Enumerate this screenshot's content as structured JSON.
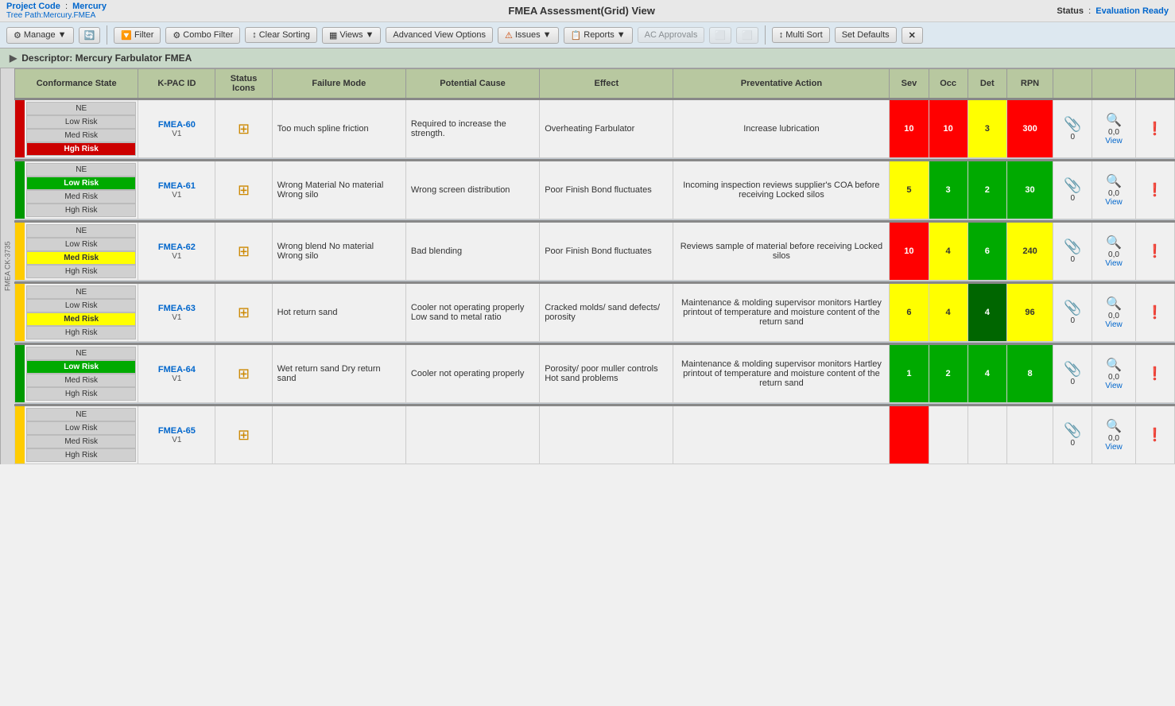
{
  "header": {
    "project_label": "Project Code",
    "project_value": "Mercury",
    "tree_path": "Tree Path:Mercury.FMEA",
    "title": "FMEA Assessment(Grid) View",
    "status_label": "Status",
    "status_value": "Evaluation Ready"
  },
  "toolbar": {
    "manage": "Manage",
    "filter": "Filter",
    "combo_filter": "Combo Filter",
    "clear_sorting": "Clear Sorting",
    "views": "Views",
    "advanced_view": "Advanced View Options",
    "issues": "Issues",
    "reports": "Reports",
    "ac_approvals": "AC Approvals",
    "multi_sort": "Multi Sort",
    "set_defaults": "Set Defaults"
  },
  "section": {
    "title": "Descriptor: Mercury Farbulator FMEA",
    "expand": "▶"
  },
  "table": {
    "headers": {
      "conformance": "Conformance State",
      "kpac": "K-PAC ID",
      "status": "Status Icons",
      "failure": "Failure Mode",
      "cause": "Potential Cause",
      "effect": "Effect",
      "preventive": "Preventative Action",
      "sev": "Sev",
      "occ": "Occ",
      "det": "Det",
      "rpn": "RPN"
    },
    "rows": [
      {
        "id": "FMEA-60",
        "version": "V1",
        "side_color": "red",
        "conformance_active": "Hgh Risk",
        "risk_states": [
          "NE",
          "Low Risk",
          "Med Risk",
          "Hgh Risk"
        ],
        "active_risk": 3,
        "failure_mode": "Too much spline friction",
        "cause": "Required to increase the strength.",
        "effect": "Overheating Farbulator",
        "preventive": "Increase lubrication",
        "sev": 10,
        "sev_color": "red",
        "occ": 10,
        "occ_color": "red",
        "det": 3,
        "det_color": "yellow",
        "rpn": 300,
        "rpn_color": "red",
        "attachments": 0,
        "view_text": "0,0\nView"
      },
      {
        "id": "FMEA-61",
        "version": "V1",
        "side_color": "green",
        "conformance_active": "Low Risk",
        "risk_states": [
          "NE",
          "Low Risk",
          "Med Risk",
          "Hgh Risk"
        ],
        "active_risk": 1,
        "failure_mode": "Wrong Material No material Wrong silo",
        "cause": "Wrong screen distribution",
        "effect": "Poor Finish Bond fluctuates",
        "preventive": "Incoming inspection reviews supplier's COA before receiving Locked silos",
        "sev": 5,
        "sev_color": "yellow",
        "occ": 3,
        "occ_color": "green",
        "det": 2,
        "det_color": "green",
        "rpn": 30,
        "rpn_color": "green",
        "attachments": 0,
        "view_text": "0,0\nView"
      },
      {
        "id": "FMEA-62",
        "version": "V1",
        "side_color": "yellow",
        "conformance_active": "Med Risk",
        "risk_states": [
          "NE",
          "Low Risk",
          "Med Risk",
          "Hgh Risk"
        ],
        "active_risk": 2,
        "failure_mode": "Wrong blend No material Wrong silo",
        "cause": "Bad blending",
        "effect": "Poor Finish Bond fluctuates",
        "preventive": "Reviews sample of material before receiving Locked silos",
        "sev": 10,
        "sev_color": "red",
        "occ": 4,
        "occ_color": "yellow",
        "det": 6,
        "det_color": "green",
        "rpn": 240,
        "rpn_color": "yellow",
        "attachments": 0,
        "view_text": "0,0\nView"
      },
      {
        "id": "FMEA-63",
        "version": "V1",
        "side_color": "yellow",
        "conformance_active": "Med Risk",
        "risk_states": [
          "NE",
          "Low Risk",
          "Med Risk",
          "Hgh Risk"
        ],
        "active_risk": 2,
        "failure_mode": "Hot return sand",
        "cause": "Cooler not operating properly\nLow sand to metal ratio",
        "effect": "Cracked molds/ sand defects/ porosity",
        "preventive": "Maintenance & molding supervisor monitors Hartley printout of temperature and moisture content of the return sand",
        "sev": 6,
        "sev_color": "yellow",
        "occ": 4,
        "occ_color": "yellow",
        "det": 4,
        "det_color": "dark-green",
        "rpn": 96,
        "rpn_color": "yellow",
        "attachments": 0,
        "view_text": "0,0\nView"
      },
      {
        "id": "FMEA-64",
        "version": "V1",
        "side_color": "green",
        "conformance_active": "Low Risk",
        "risk_states": [
          "NE",
          "Low Risk",
          "Med Risk",
          "Hgh Risk"
        ],
        "active_risk": 1,
        "failure_mode": "Wet return sand Dry return sand",
        "cause": "Cooler not operating properly",
        "effect": "Porosity/ poor muller controls Hot sand problems",
        "preventive": "Maintenance & molding supervisor monitors Hartley printout of temperature and moisture content of the return sand",
        "sev": 1,
        "sev_color": "green",
        "occ": 2,
        "occ_color": "green",
        "det": 4,
        "det_color": "green",
        "rpn": 8,
        "rpn_color": "green",
        "attachments": 0,
        "view_text": "0,0\nView"
      },
      {
        "id": "FMEA-65",
        "version": "V1",
        "side_color": "yellow",
        "conformance_active": "NE",
        "risk_states": [
          "NE",
          "Low Risk",
          "Med Risk",
          "Hgh Risk"
        ],
        "active_risk": 0,
        "failure_mode": "",
        "cause": "",
        "effect": "",
        "preventive": "",
        "sev": null,
        "sev_color": "red",
        "occ": null,
        "occ_color": "",
        "det": null,
        "det_color": "",
        "rpn": null,
        "rpn_color": "",
        "attachments": 0,
        "view_text": ""
      }
    ]
  },
  "side_label": "FMEA CK-3735",
  "icons": {
    "manage": "▼",
    "filter": "⚙",
    "combo_filter": "⚙",
    "clear_sorting": "↕",
    "views": "▦",
    "issues": "⚠",
    "reports": "📋",
    "multi_sort": "↕↑",
    "paperclip": "📎",
    "magnify": "🔍",
    "exclaim": "❗",
    "expand": "▶",
    "close": "✕",
    "status_icon": "⊞"
  }
}
